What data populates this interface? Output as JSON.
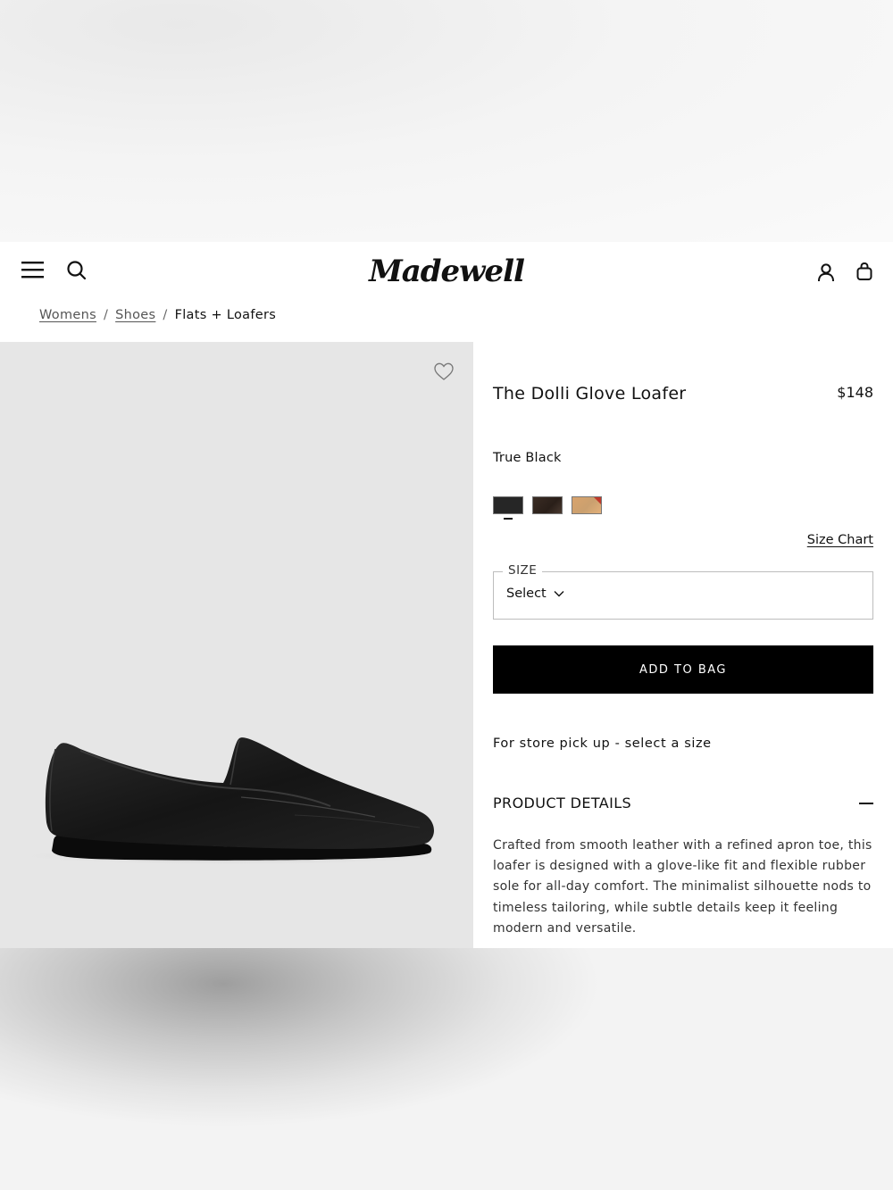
{
  "header": {
    "logo_text": "Madewell"
  },
  "breadcrumb": {
    "items": [
      "Womens",
      "Shoes"
    ],
    "separator": "/",
    "current": "Flats + Loafers"
  },
  "product": {
    "title": "The Dolli Glove Loafer",
    "price": "$148",
    "color_name": "True Black",
    "swatches": [
      {
        "name": "black",
        "color": "#262626"
      },
      {
        "name": "dark-brown",
        "color": "#33261f"
      },
      {
        "name": "tan",
        "color": "#d4a06c"
      }
    ],
    "size_chart_label": "Size Chart",
    "size_label": "SIZE",
    "size_value": "Select",
    "add_to_bag_label": "ADD TO BAG",
    "pickup_text": "For store pick up - select a size",
    "details_title": "PRODUCT DETAILS",
    "details_text": "Crafted from smooth leather with a refined apron toe, this loafer is designed with a glove-like fit and flexible rubber sole for all-day comfort. The minimalist silhouette nods to timeless tailoring, while subtle details keep it feeling modern and versatile."
  }
}
